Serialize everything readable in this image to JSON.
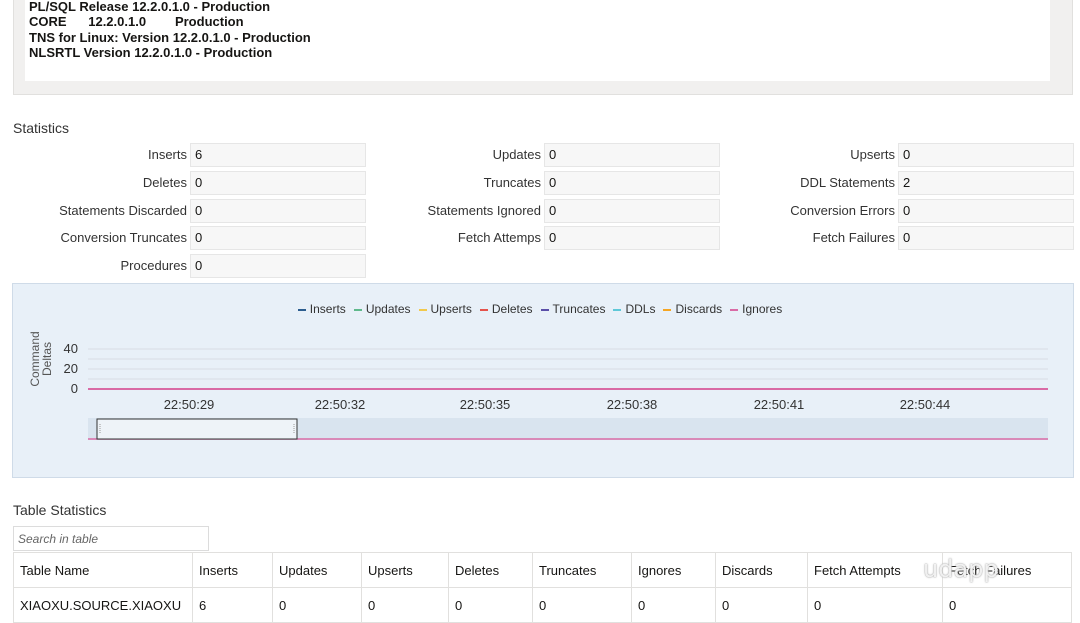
{
  "version_info": {
    "lines": [
      "PL/SQL Release 12.2.0.1.0 - Production",
      "CORE      12.2.0.1.0        Production",
      "TNS for Linux: Version 12.2.0.1.0 - Production",
      "NLSRTL Version 12.2.0.1.0 - Production"
    ]
  },
  "statistics": {
    "title": "Statistics",
    "items": [
      {
        "label": "Inserts",
        "value": "6"
      },
      {
        "label": "Updates",
        "value": "0"
      },
      {
        "label": "Upserts",
        "value": "0"
      },
      {
        "label": "Deletes",
        "value": "0"
      },
      {
        "label": "Truncates",
        "value": "0"
      },
      {
        "label": "DDL Statements",
        "value": "2"
      },
      {
        "label": "Statements Discarded",
        "value": "0"
      },
      {
        "label": "Statements Ignored",
        "value": "0"
      },
      {
        "label": "Conversion Errors",
        "value": "0"
      },
      {
        "label": "Conversion Truncates",
        "value": "0"
      },
      {
        "label": "Fetch Attemps",
        "value": "0"
      },
      {
        "label": "Fetch Failures",
        "value": "0"
      },
      {
        "label": "Procedures",
        "value": "0"
      }
    ]
  },
  "chart_data": {
    "type": "line",
    "ylabel": "Command Deltas",
    "ylim": [
      0,
      50
    ],
    "yticks": [
      "0",
      "20",
      "40"
    ],
    "x": [
      "22:50:29",
      "22:50:32",
      "22:50:35",
      "22:50:38",
      "22:50:41",
      "22:50:44"
    ],
    "series": [
      {
        "name": "Inserts",
        "color": "#2c5d8f",
        "values": [
          0,
          0,
          0,
          0,
          0,
          0
        ]
      },
      {
        "name": "Updates",
        "color": "#5fb98c",
        "values": [
          0,
          0,
          0,
          0,
          0,
          0
        ]
      },
      {
        "name": "Upserts",
        "color": "#f2c94c",
        "values": [
          0,
          0,
          0,
          0,
          0,
          0
        ]
      },
      {
        "name": "Deletes",
        "color": "#e5534b",
        "values": [
          0,
          0,
          0,
          0,
          0,
          0
        ]
      },
      {
        "name": "Truncates",
        "color": "#5a4fa8",
        "values": [
          0,
          0,
          0,
          0,
          0,
          0
        ]
      },
      {
        "name": "DDLs",
        "color": "#5ec8d8",
        "values": [
          0,
          0,
          0,
          0,
          0,
          0
        ]
      },
      {
        "name": "Discards",
        "color": "#f5a623",
        "values": [
          0,
          0,
          0,
          0,
          0,
          0
        ]
      },
      {
        "name": "Ignores",
        "color": "#d96ba6",
        "values": [
          0,
          0,
          0,
          0,
          0,
          0
        ]
      }
    ],
    "grid": true,
    "legend": "top-center"
  },
  "table_statistics": {
    "title": "Table Statistics",
    "search_placeholder": "Search in table",
    "columns": [
      "Table Name",
      "Inserts",
      "Updates",
      "Upserts",
      "Deletes",
      "Truncates",
      "Ignores",
      "Discards",
      "Fetch Attempts",
      "Fetch Failures"
    ],
    "rows": [
      [
        "XIAOXU.SOURCE.XIAOXU",
        "6",
        "0",
        "0",
        "0",
        "0",
        "0",
        "0",
        "0",
        "0"
      ]
    ]
  },
  "watermark": "udapp"
}
